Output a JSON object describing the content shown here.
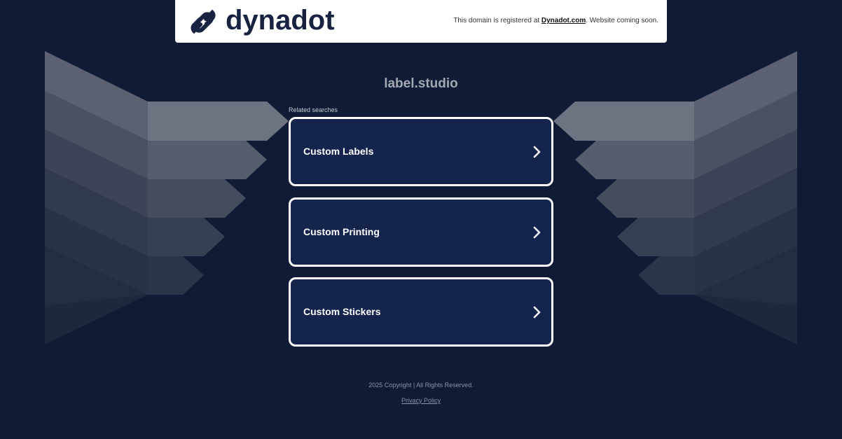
{
  "header": {
    "logo_text": "dynadot",
    "message_prefix": "This domain is registered at ",
    "message_link": "Dynadot.com",
    "message_suffix": ". Website coming soon."
  },
  "domain": "label.studio",
  "related": {
    "label": "Related searches",
    "items": [
      {
        "label": "Custom Labels",
        "icon": "chevron-right-icon"
      },
      {
        "label": "Custom Printing",
        "icon": "chevron-right-icon"
      },
      {
        "label": "Custom Stickers",
        "icon": "chevron-right-icon"
      }
    ]
  },
  "footer": {
    "copyright": "2025 Copyright | All Rights Reserved.",
    "privacy": "Privacy Policy"
  },
  "colors": {
    "background": "#101c36",
    "card": "#14244d",
    "logo": "#172340"
  }
}
